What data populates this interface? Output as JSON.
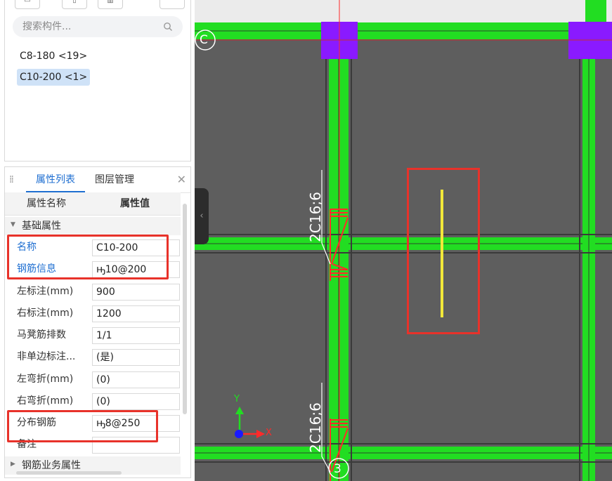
{
  "search": {
    "placeholder": "搜索构件..."
  },
  "components": [
    {
      "label": "C8-180 <19>"
    },
    {
      "label": "C10-200 <1>"
    }
  ],
  "tabs": {
    "properties": "属性列表",
    "layers": "图层管理"
  },
  "columns": {
    "name": "属性名称",
    "value": "属性值"
  },
  "groups": {
    "basic": "基础属性",
    "business": "钢筋业务属性"
  },
  "properties": [
    {
      "name": "名称",
      "value": "C10-200"
    },
    {
      "name": "钢筋信息",
      "value": "ԣ10@200"
    },
    {
      "name": "左标注(mm)",
      "value": "900"
    },
    {
      "name": "右标注(mm)",
      "value": "1200"
    },
    {
      "name": "马凳筋排数",
      "value": "1/1"
    },
    {
      "name": "非单边标注...",
      "value": "(是)"
    },
    {
      "name": "左弯折(mm)",
      "value": "(0)"
    },
    {
      "name": "右弯折(mm)",
      "value": "(0)"
    },
    {
      "name": "分布钢筋",
      "value": "ԣ8@250"
    },
    {
      "name": "备注",
      "value": ""
    }
  ],
  "cad": {
    "axis_c": "C",
    "axis_3": "3",
    "rebar_label_top": "2C16;6",
    "rebar_label_bottom": "2C16;6",
    "ucs_x": "X",
    "ucs_y": "Y"
  },
  "colors": {
    "accent": "#1f6fd1",
    "highlight": "#e8322a",
    "beam": "#22dd22",
    "column": "#8a1aff",
    "rebar": "#ff2a2a",
    "selected_bar": "#f2e83a",
    "canvas_bg": "#5e5e5e"
  }
}
